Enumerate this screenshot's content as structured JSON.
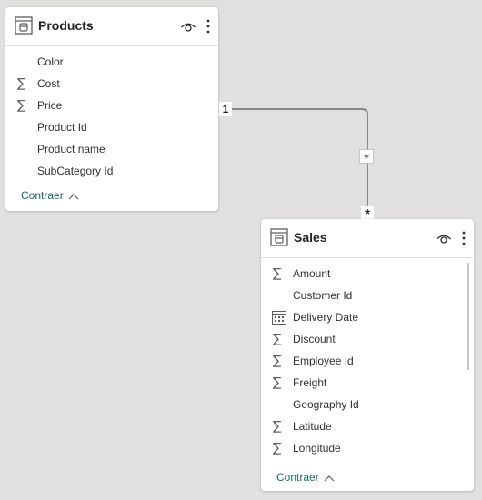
{
  "tables": {
    "products": {
      "title": "Products",
      "fields": [
        {
          "name": "Color",
          "icon": "none"
        },
        {
          "name": "Cost",
          "icon": "sigma-icon"
        },
        {
          "name": "Price",
          "icon": "sigma-icon"
        },
        {
          "name": "Product Id",
          "icon": "none"
        },
        {
          "name": "Product name",
          "icon": "none"
        },
        {
          "name": "SubCategory Id",
          "icon": "none"
        }
      ],
      "collapse_label": "Contraer"
    },
    "sales": {
      "title": "Sales",
      "fields": [
        {
          "name": "Amount",
          "icon": "sigma-icon"
        },
        {
          "name": "Customer Id",
          "icon": "none"
        },
        {
          "name": "Delivery Date",
          "icon": "calendar-icon"
        },
        {
          "name": "Discount",
          "icon": "sigma-icon"
        },
        {
          "name": "Employee Id",
          "icon": "sigma-icon"
        },
        {
          "name": "Freight",
          "icon": "sigma-icon"
        },
        {
          "name": "Geography Id",
          "icon": "none"
        },
        {
          "name": "Latitude",
          "icon": "sigma-icon"
        },
        {
          "name": "Longitude",
          "icon": "sigma-icon"
        }
      ],
      "collapse_label": "Contraer"
    }
  },
  "relationship": {
    "from_cardinality": "1",
    "to_cardinality": "*"
  },
  "colors": {
    "canvas": "#e1e0df",
    "link": "#1b6a63",
    "line": "#8a8886"
  }
}
